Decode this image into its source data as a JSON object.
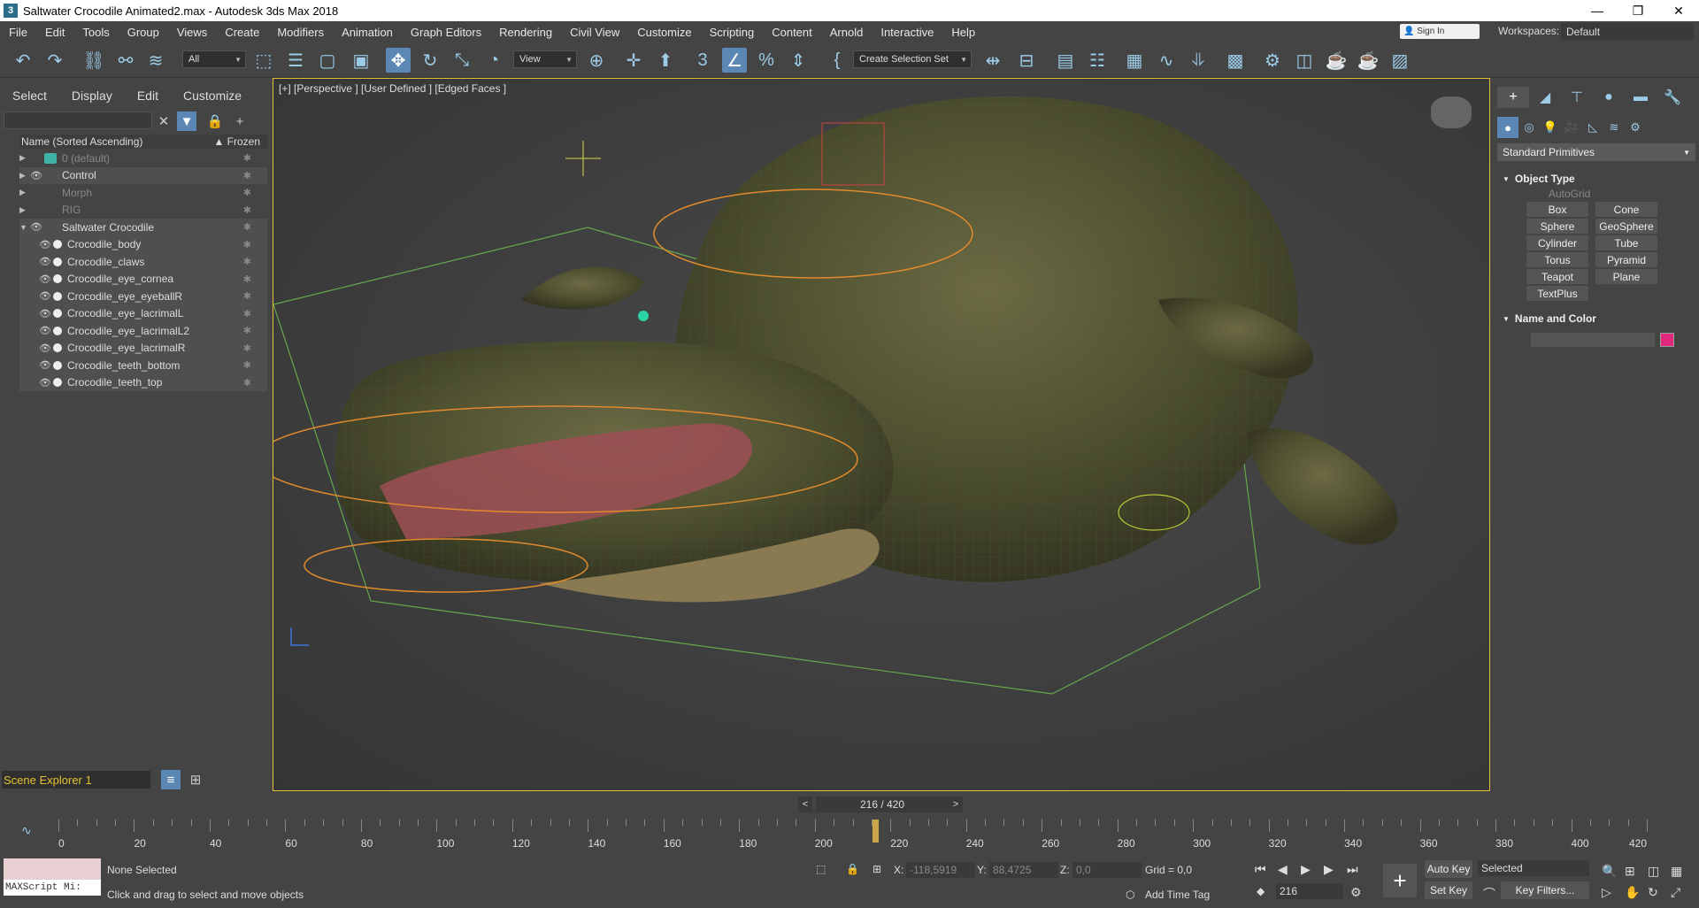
{
  "window": {
    "title": "Saltwater Crocodile Animated2.max - Autodesk 3ds Max 2018"
  },
  "menu": [
    "File",
    "Edit",
    "Tools",
    "Group",
    "Views",
    "Create",
    "Modifiers",
    "Animation",
    "Graph Editors",
    "Rendering",
    "Civil View",
    "Customize",
    "Scripting",
    "Content",
    "Arnold",
    "Interactive",
    "Help"
  ],
  "signin": "Sign In",
  "workspaces": {
    "label": "Workspaces:",
    "value": "Default"
  },
  "toolbar": {
    "filter": "All",
    "refcoord": "View",
    "selset": "Create Selection Set"
  },
  "explorer": {
    "tabs": [
      "Select",
      "Display",
      "Edit",
      "Customize"
    ],
    "header": "Name (Sorted Ascending)",
    "frozen_header": "▲ Frozen",
    "rows": [
      {
        "name": "0 (default)",
        "type": "layer",
        "dim": true
      },
      {
        "name": "Control",
        "type": "group",
        "dim": false
      },
      {
        "name": "Morph",
        "type": "group",
        "dim": true
      },
      {
        "name": "RIG",
        "type": "group",
        "dim": true
      },
      {
        "name": "Saltwater Crocodile",
        "type": "group",
        "dim": false
      },
      {
        "name": "Crocodile_body",
        "type": "obj"
      },
      {
        "name": "Crocodile_claws",
        "type": "obj"
      },
      {
        "name": "Crocodile_eye_cornea",
        "type": "obj"
      },
      {
        "name": "Crocodile_eye_eyeballR",
        "type": "obj"
      },
      {
        "name": "Crocodile_eye_lacrimalL",
        "type": "obj"
      },
      {
        "name": "Crocodile_eye_lacrimalL2",
        "type": "obj"
      },
      {
        "name": "Crocodile_eye_lacrimalR",
        "type": "obj"
      },
      {
        "name": "Crocodile_teeth_bottom",
        "type": "obj"
      },
      {
        "name": "Crocodile_teeth_top",
        "type": "obj"
      }
    ],
    "footer": "Scene Explorer 1"
  },
  "viewport": {
    "label": "[+] [Perspective ] [User Defined ] [Edged Faces ]"
  },
  "cmdpanel": {
    "category": "Standard Primitives",
    "object_type": "Object Type",
    "autogrid": "AutoGrid",
    "objects": [
      "Box",
      "Cone",
      "Sphere",
      "GeoSphere",
      "Cylinder",
      "Tube",
      "Torus",
      "Pyramid",
      "Teapot",
      "Plane",
      "TextPlus"
    ],
    "name_color": "Name and Color",
    "swatch_color": "#e0287c"
  },
  "timeline": {
    "frame_label": "216 / 420",
    "ticks": [
      0,
      20,
      40,
      60,
      80,
      100,
      120,
      140,
      160,
      180,
      200,
      220,
      240,
      260,
      280,
      300,
      320,
      340,
      360,
      380,
      400,
      420
    ],
    "current": 216,
    "total": 420
  },
  "status": {
    "maxscript": "MAXScript Mi:",
    "selection": "None Selected",
    "prompt": "Click and drag to select and move objects",
    "x_label": "X:",
    "x_val": "-118,5919",
    "y_label": "Y:",
    "y_val": "88,4725",
    "z_label": "Z:",
    "z_val": "0,0",
    "grid": "Grid = 0,0",
    "addtime": "Add Time Tag",
    "autokey": "Auto Key",
    "setkey": "Set Key",
    "selected": "Selected",
    "keyfilters": "Key Filters...",
    "frame": "216"
  }
}
